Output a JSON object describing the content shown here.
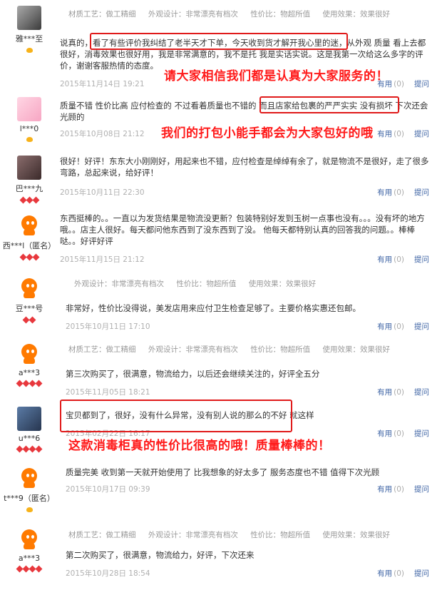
{
  "reviews": [
    {
      "user": "雅***至",
      "tags": [
        "材质工艺：做工精细",
        "外观设计：非常漂亮有档次",
        "性价比：物超所值",
        "使用效果：效果很好"
      ],
      "text": "说真的，看了有些评价我纠结了老半天才下单，今天收到货才解开我心里的迷，从外观 质量 看上去都很好，消毒效果也很好用，我是非常满意的，我不是托 我是实话实说。这是我第一次给这么多字的评价，谢谢客服热情的态度。",
      "date": "2015年11月14日 19:21",
      "useful": "有用",
      "count": "(0)",
      "ask": "提问"
    },
    {
      "user": "l***0",
      "tags": [],
      "text": "质量不错 性价比高 应付检查的 不过看着质量也不错的 而且店家给包裹的严严实实 没有损坏 下次还会光顾的",
      "date": "2015年10月08日 21:12",
      "useful": "有用",
      "count": "(0)",
      "ask": "提问"
    },
    {
      "user": "巴***九",
      "tags": [],
      "text": "很好！好评！东东大小刚刚好，用起来也不错，应付检查是绰绰有余了，就是物流不是很好，走了很多弯路，总起来说，给好评！",
      "date": "2015年10月11日 22:30",
      "useful": "有用",
      "count": "(0)",
      "ask": "提问"
    },
    {
      "user": "西***l（匿名）",
      "tags": [],
      "text": "东西挺棒的。。一直以为发货结果是物流没更新？包装特别好发到玉树一点事也没有。。。没有坏的地方哦。。店主人很好。每天都问他东西到了没东西到了没。 他每天都特别认真的回答我的问题。。棒棒哒。。好评好评",
      "date": "2015年11月15日 21:12",
      "useful": "有用",
      "count": "(0)",
      "ask": "提问"
    },
    {
      "user": "豆***号",
      "tags": [
        "外观设计：非常漂亮有档次",
        "性价比：物超所值",
        "使用效果：效果很好"
      ],
      "text": "非常好，性价比没得说，美发店用来应付卫生检查足够了。主要价格实惠还包邮。",
      "date": "2015年10月11日 17:10",
      "useful": "有用",
      "count": "(0)",
      "ask": "提问"
    },
    {
      "user": "a***3",
      "tags": [
        "材质工艺：做工精细",
        "外观设计：非常漂亮有档次",
        "性价比：物超所值",
        "使用效果：效果很好"
      ],
      "text": "第三次购买了，很满意，物流给力，以后还会继续关注的，好评全五分",
      "date": "2015年11月05日 18:21",
      "useful": "有用",
      "count": "(0)",
      "ask": "提问"
    },
    {
      "user": "u***6",
      "tags": [],
      "text": "宝贝都到了，很好，没有什么异常，没有别人说的那么的不好 就这样",
      "date": "2015年02月22日 16:17",
      "useful": "有用",
      "count": "(0)",
      "ask": "提问"
    },
    {
      "user": "t***9（匿名）",
      "tags": [],
      "text": "质量完美 收到第一天就开始使用了 比我想象的好太多了 服务态度也不错 值得下次光顾",
      "date": "2015年10月17日 09:39",
      "useful": "有用",
      "count": "(0)",
      "ask": "提问"
    },
    {
      "user": "a***3",
      "tags": [
        "材质工艺：做工精细",
        "外观设计：非常漂亮有档次",
        "性价比：物超所值",
        "使用效果：效果很好"
      ],
      "text": "第二次购买了，很满意，物流给力，好评，下次还来",
      "date": "2015年10月28日 18:54",
      "useful": "有用",
      "count": "(0)",
      "ask": "提问"
    }
  ],
  "overlays": {
    "o1": "请大家相信我们都是认真为大家服务的！",
    "o2": "我们的打包小能手都会为大家包好的哦",
    "o3": "这款消毒柜真的性价比很高的哦！质量棒棒的！"
  },
  "colors": {
    "annotation_red": "#ff1a1a",
    "link_blue": "#3d63a4",
    "taobao_orange": "#ff7a00"
  }
}
